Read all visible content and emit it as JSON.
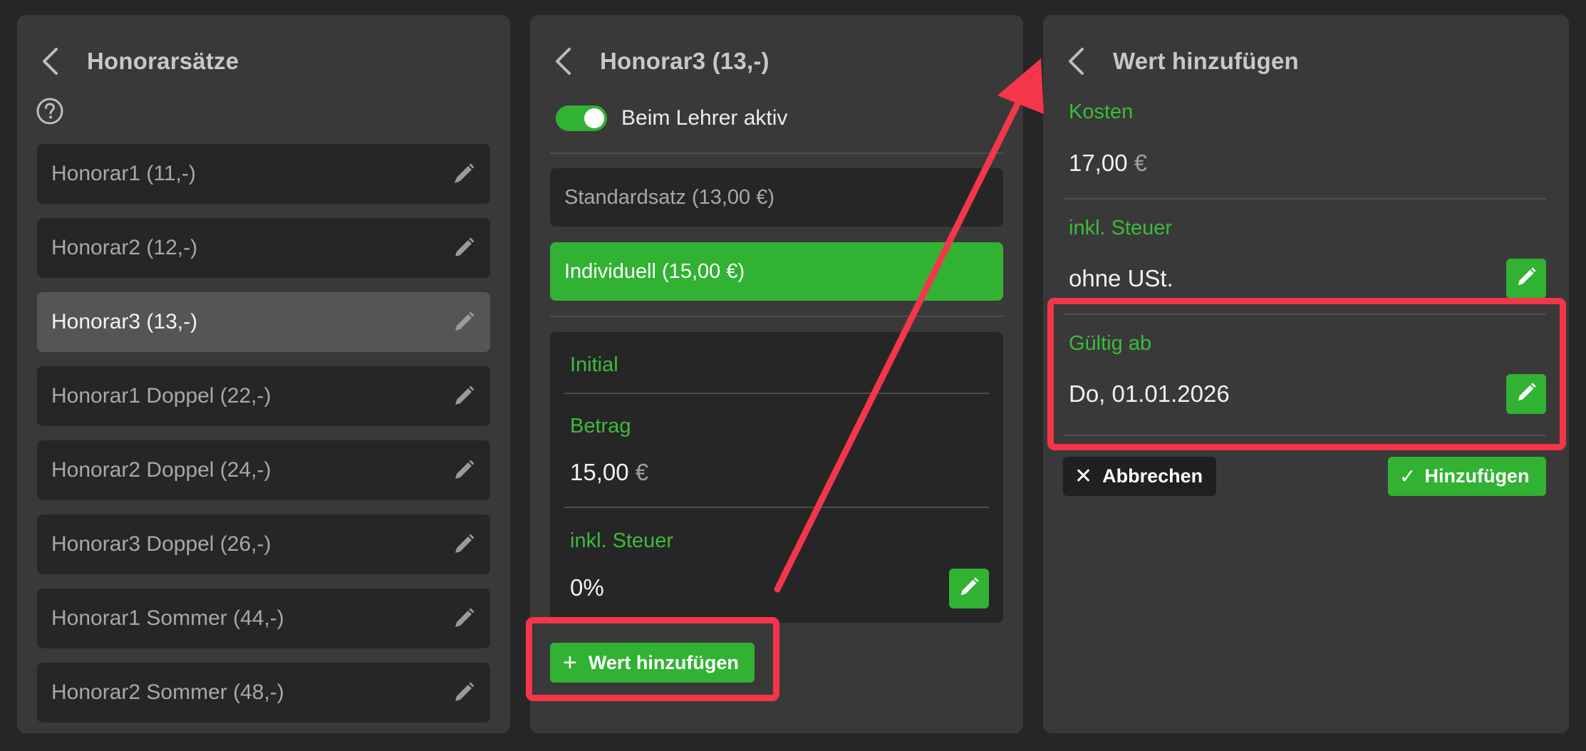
{
  "panel_rates": {
    "title": "Honorarsätze",
    "items": [
      {
        "label": "Honorar1 (11,-)"
      },
      {
        "label": "Honorar2 (12,-)"
      },
      {
        "label": "Honorar3 (13,-)"
      },
      {
        "label": "Honorar1 Doppel (22,-)"
      },
      {
        "label": "Honorar2 Doppel (24,-)"
      },
      {
        "label": "Honorar3 Doppel (26,-)"
      },
      {
        "label": "Honorar1 Sommer (44,-)"
      },
      {
        "label": "Honorar2 Sommer (48,-)"
      }
    ],
    "selected_index": 2
  },
  "panel_detail": {
    "title": "Honorar3 (13,-)",
    "toggle_label": "Beim Lehrer aktiv",
    "toggle_on": true,
    "option_standard": "Standardsatz (13,00 €)",
    "option_individual": "Individuell (15,00 €)",
    "initial_label": "Initial",
    "amount_label": "Betrag",
    "amount_value": "15,00",
    "amount_unit": "€",
    "tax_label": "inkl. Steuer",
    "tax_value": "0%",
    "add_button": "Wert hinzufügen"
  },
  "panel_add": {
    "title": "Wert hinzufügen",
    "cost_label": "Kosten",
    "cost_value": "17,00",
    "cost_unit": "€",
    "tax_label": "inkl. Steuer",
    "tax_value": "ohne USt.",
    "valid_from_label": "Gültig ab",
    "valid_from_value": "Do, 01.01.2026",
    "cancel_button": "Abbrechen",
    "confirm_button": "Hinzufügen"
  },
  "colors": {
    "accent_green": "#32b233",
    "label_green": "#3cbb3c",
    "annotation_red": "#f4364a",
    "background": "#262626",
    "panel": "#393939"
  },
  "icons": [
    "chevron-left-icon",
    "help-circle-icon",
    "pencil-icon",
    "plus-icon",
    "close-icon",
    "check-icon"
  ]
}
